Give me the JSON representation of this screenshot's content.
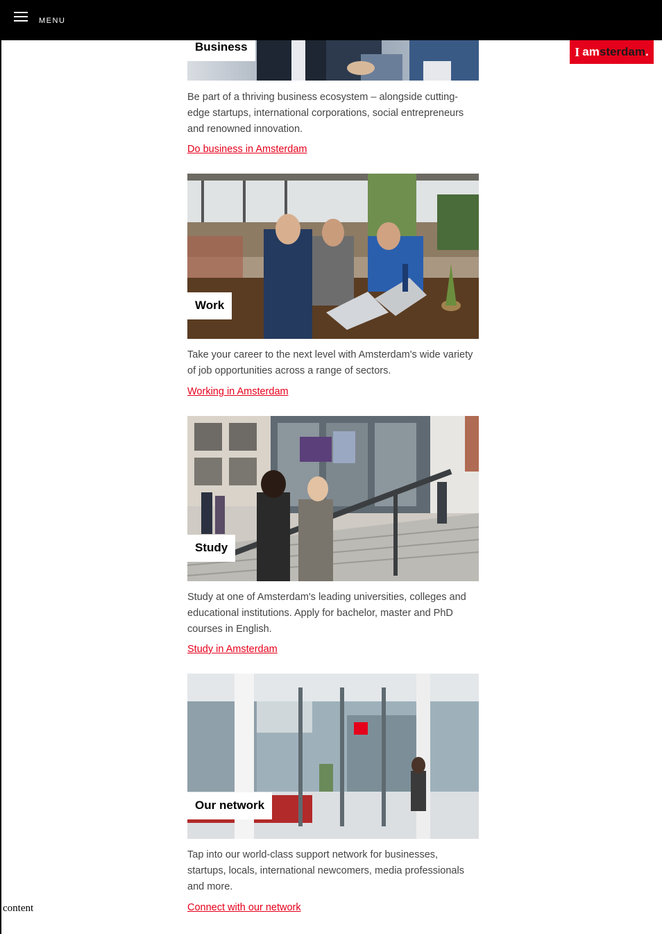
{
  "header": {
    "menu_label": "MENU"
  },
  "logo": {
    "i": "I",
    "am": "am",
    "sterdam": "sterdam",
    "dot": "."
  },
  "cards": [
    {
      "label": "Business",
      "text": "Be part of a thriving business ecosystem – alongside cutting-edge startups, international corporations, social entrepreneurs and renowned innovation.",
      "link": "Do business in Amsterdam"
    },
    {
      "label": "Work",
      "text": "Take your career to the next level with Amsterdam's wide variety of job opportunities across a range of sectors.",
      "link": "Working in Amsterdam"
    },
    {
      "label": "Study",
      "text": "Study at one of Amsterdam's leading universities, colleges and educational institutions. Apply for bachelor, master and PhD courses in English.",
      "link": "Study in Amsterdam"
    },
    {
      "label": "Our network",
      "text": "Tap into our world-class support network for businesses, startups, locals, international newcomers, media professionals and more.",
      "link": "Connect with our network"
    }
  ],
  "footer_note": "content",
  "colors": {
    "accent": "#e5001b",
    "topbar": "#000000"
  }
}
